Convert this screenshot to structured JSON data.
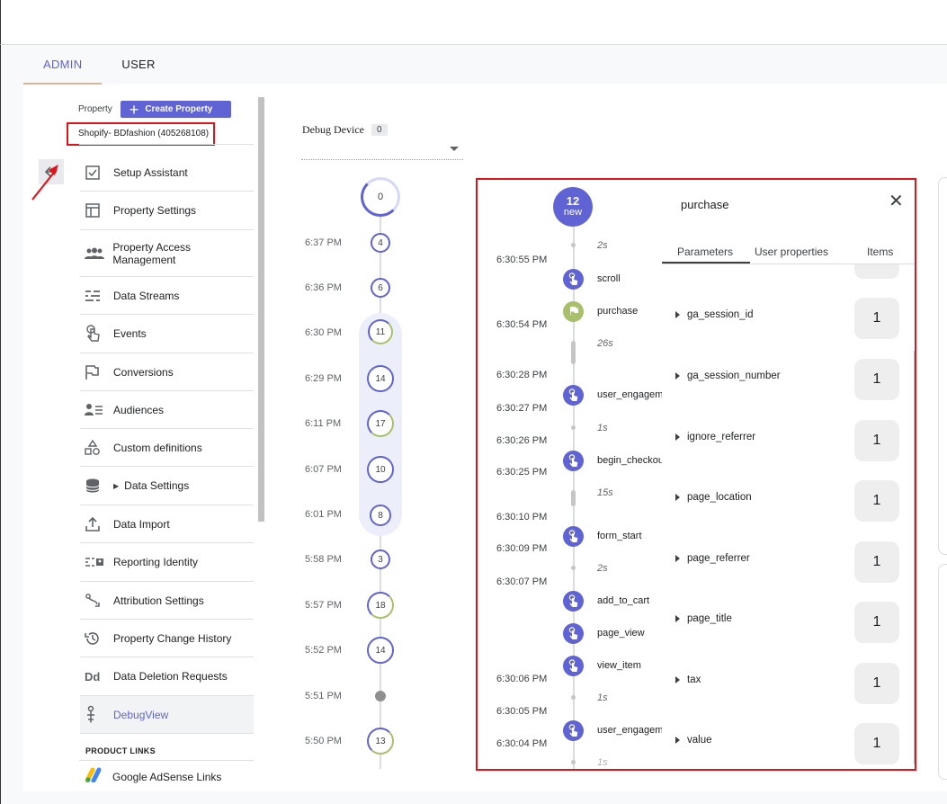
{
  "tabs": [
    {
      "label": "ADMIN",
      "active": true
    },
    {
      "label": "USER",
      "active": false
    }
  ],
  "property": {
    "label": "Property",
    "create_button": "Create Property",
    "name": "Shopify- BDfashion (405268108)"
  },
  "nav": {
    "items": [
      {
        "label": "Setup Assistant",
        "icon": "checkbox-icon"
      },
      {
        "label": "Property Settings",
        "icon": "layout-icon"
      },
      {
        "label": "Property Access Management",
        "icon": "people-icon"
      },
      {
        "label": "Data Streams",
        "icon": "streams-icon"
      },
      {
        "label": "Events",
        "icon": "touch-icon"
      },
      {
        "label": "Conversions",
        "icon": "flag-icon"
      },
      {
        "label": "Audiences",
        "icon": "audience-icon"
      },
      {
        "label": "Custom definitions",
        "icon": "shapes-icon"
      },
      {
        "label": "Data Settings",
        "icon": "database-icon"
      },
      {
        "label": "Data Import",
        "icon": "upload-icon"
      },
      {
        "label": "Reporting Identity",
        "icon": "identity-icon"
      },
      {
        "label": "Attribution Settings",
        "icon": "attribution-icon"
      },
      {
        "label": "Property Change History",
        "icon": "history-icon"
      },
      {
        "label": "Data Deletion Requests",
        "icon": "dd-icon"
      },
      {
        "label": "DebugView",
        "icon": "debug-icon"
      }
    ],
    "product_links_header": "PRODUCT LINKS",
    "adsense": "Google AdSense Links"
  },
  "debug_device": {
    "label": "Debug Device",
    "count": "0"
  },
  "minutes": {
    "top_count": "0",
    "rows": [
      {
        "time": "6:37 PM",
        "count": "4"
      },
      {
        "time": "6:36 PM",
        "count": "6"
      },
      {
        "time": "6:30 PM",
        "count": "11"
      },
      {
        "time": "6:29 PM",
        "count": "14"
      },
      {
        "time": "6:11 PM",
        "count": "17"
      },
      {
        "time": "6:07 PM",
        "count": "10"
      },
      {
        "time": "6:01 PM",
        "count": "8"
      },
      {
        "time": "5:58 PM",
        "count": "3"
      },
      {
        "time": "5:57 PM",
        "count": "18"
      },
      {
        "time": "5:52 PM",
        "count": "14"
      },
      {
        "time": "5:51 PM",
        "count": ""
      },
      {
        "time": "5:50 PM",
        "count": "13"
      }
    ]
  },
  "stream": {
    "badge_count": "12",
    "badge_label": "new",
    "times": [
      "6:30:55 PM",
      "6:30:54 PM",
      "6:30:28 PM",
      "6:30:27 PM",
      "6:30:26 PM",
      "6:30:25 PM",
      "6:30:10 PM",
      "6:30:09 PM",
      "6:30:07 PM",
      "6:30:06 PM",
      "6:30:05 PM",
      "6:30:04 PM"
    ],
    "durations": [
      "2s",
      "26s",
      "1s",
      "15s",
      "2s",
      "1s",
      "1s"
    ],
    "events": [
      "scroll",
      "purchase",
      "user_engagement",
      "begin_checkout",
      "form_start",
      "add_to_cart",
      "page_view",
      "view_item",
      "user_engagement"
    ]
  },
  "detail": {
    "title": "purchase",
    "tabs": [
      "Parameters",
      "User properties",
      "Items"
    ],
    "params": [
      {
        "key": "ga_session_id",
        "value": "1"
      },
      {
        "key": "ga_session_number",
        "value": "1"
      },
      {
        "key": "ignore_referrer",
        "value": "1"
      },
      {
        "key": "page_location",
        "value": "1"
      },
      {
        "key": "page_referrer",
        "value": "1"
      },
      {
        "key": "page_title",
        "value": "1"
      },
      {
        "key": "tax",
        "value": "1"
      },
      {
        "key": "value",
        "value": "1"
      }
    ]
  },
  "colors": {
    "accent": "#5f63d4",
    "highlight": "#e0151b",
    "conversion": "#a8c06a"
  }
}
